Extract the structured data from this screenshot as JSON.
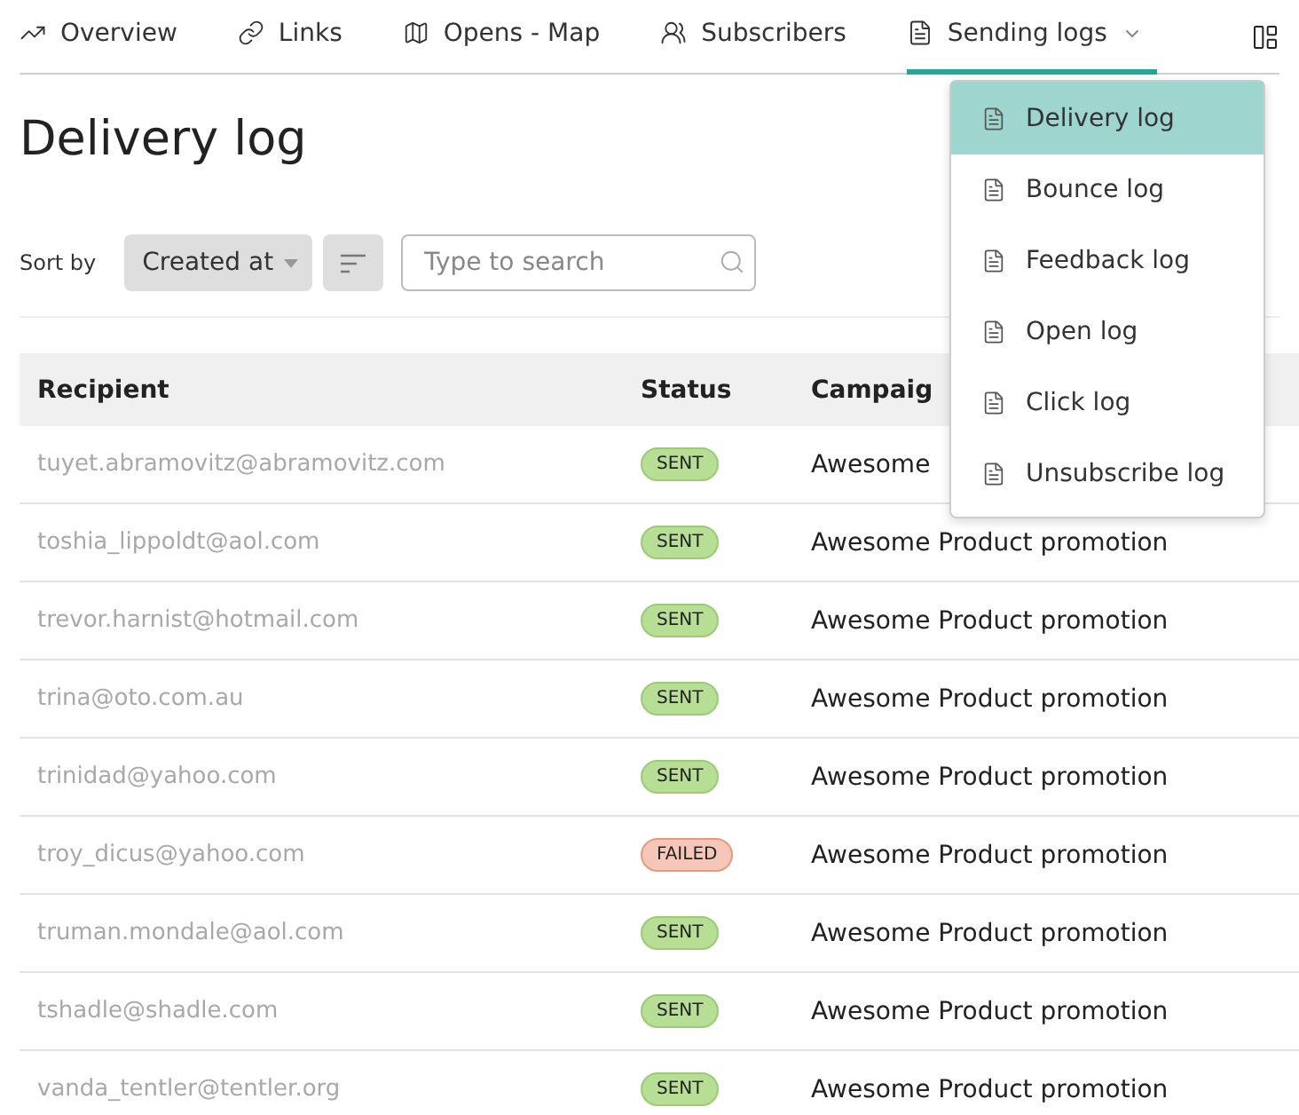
{
  "nav": {
    "tabs": [
      {
        "label": "Overview",
        "selected": false
      },
      {
        "label": "Links",
        "selected": false
      },
      {
        "label": "Opens - Map",
        "selected": false
      },
      {
        "label": "Subscribers",
        "selected": false
      },
      {
        "label": "Sending logs",
        "selected": true,
        "expanded": true
      }
    ]
  },
  "dropdown": {
    "items": [
      {
        "label": "Delivery log",
        "selected": true
      },
      {
        "label": "Bounce log",
        "selected": false
      },
      {
        "label": "Feedback log",
        "selected": false
      },
      {
        "label": "Open log",
        "selected": false
      },
      {
        "label": "Click log",
        "selected": false
      },
      {
        "label": "Unsubscribe log",
        "selected": false
      }
    ]
  },
  "page_title": "Delivery log",
  "toolbar": {
    "sort_label": "Sort by",
    "sort_value": "Created at",
    "search": {
      "placeholder": "Type to search"
    }
  },
  "table": {
    "columns": [
      "Recipient",
      "Status",
      "Campaig"
    ],
    "rows": [
      {
        "recipient": "tuyet.abramovitz@abramovitz.com",
        "status": {
          "label": "SENT",
          "kind": "sent"
        },
        "campaign": "Awesome"
      },
      {
        "recipient": "toshia_lippoldt@aol.com",
        "status": {
          "label": "SENT",
          "kind": "sent"
        },
        "campaign": "Awesome Product promotion"
      },
      {
        "recipient": "trevor.harnist@hotmail.com",
        "status": {
          "label": "SENT",
          "kind": "sent"
        },
        "campaign": "Awesome Product promotion"
      },
      {
        "recipient": "trina@oto.com.au",
        "status": {
          "label": "SENT",
          "kind": "sent"
        },
        "campaign": "Awesome Product promotion"
      },
      {
        "recipient": "trinidad@yahoo.com",
        "status": {
          "label": "SENT",
          "kind": "sent"
        },
        "campaign": "Awesome Product promotion"
      },
      {
        "recipient": "troy_dicus@yahoo.com",
        "status": {
          "label": "FAILED",
          "kind": "failed"
        },
        "campaign": "Awesome Product promotion"
      },
      {
        "recipient": "truman.mondale@aol.com",
        "status": {
          "label": "SENT",
          "kind": "sent"
        },
        "campaign": "Awesome Product promotion"
      },
      {
        "recipient": "tshadle@shadle.com",
        "status": {
          "label": "SENT",
          "kind": "sent"
        },
        "campaign": "Awesome Product promotion"
      },
      {
        "recipient": "vanda_tentler@tentler.org",
        "status": {
          "label": "SENT",
          "kind": "sent"
        },
        "campaign": "Awesome Product promotion"
      }
    ]
  }
}
